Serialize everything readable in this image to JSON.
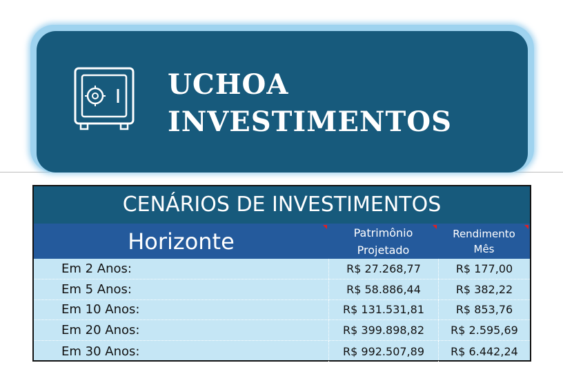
{
  "banner": {
    "icon": "safe-icon",
    "title_line1": "UCHOA",
    "title_line2": "INVESTIMENTOS"
  },
  "table": {
    "title": "CENÁRIOS DE INVESTIMENTOS",
    "headers": {
      "horizon": "Horizonte",
      "patrimony_line1": "Patrimônio",
      "patrimony_line2": "Projetado",
      "income_line1": "Rendimento",
      "income_line2": "Mês"
    },
    "rows": [
      {
        "label": "Em 2 Anos:",
        "patrimony": "R$ 27.268,77",
        "income": "R$ 177,00"
      },
      {
        "label": "Em 5 Anos:",
        "patrimony": "R$ 58.886,44",
        "income": "R$ 382,22"
      },
      {
        "label": "Em 10 Anos:",
        "patrimony": "R$ 131.531,81",
        "income": "R$ 853,76"
      },
      {
        "label": "Em 20 Anos:",
        "patrimony": "R$ 399.898,82",
        "income": "R$ 2.595,69"
      },
      {
        "label": "Em 30 Anos:",
        "patrimony": "R$ 992.507,89",
        "income": "R$ 6.442,24"
      }
    ]
  },
  "colors": {
    "banner_fill": "#175a7c",
    "banner_border": "#9fd3ef",
    "table_title_fill": "#175a7c",
    "header_fill": "#245a9c",
    "row_fill": "#c5e6f5",
    "comment_marker": "#e02020"
  }
}
